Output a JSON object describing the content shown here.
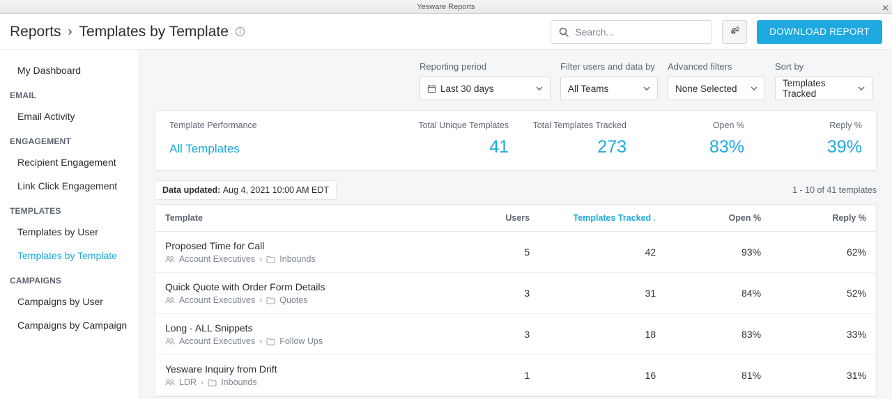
{
  "window": {
    "title": "Yesware Reports"
  },
  "breadcrumb": {
    "root": "Reports",
    "current": "Templates by Template"
  },
  "search": {
    "placeholder": "Search..."
  },
  "download_btn": "DOWNLOAD REPORT",
  "sidebar": {
    "my_dashboard": "My Dashboard",
    "sections": [
      {
        "heading": "EMAIL",
        "items": [
          "Email Activity"
        ]
      },
      {
        "heading": "ENGAGEMENT",
        "items": [
          "Recipient Engagement",
          "Link Click Engagement"
        ]
      },
      {
        "heading": "TEMPLATES",
        "items": [
          "Templates by User",
          "Templates by Template"
        ]
      },
      {
        "heading": "CAMPAIGNS",
        "items": [
          "Campaigns by User",
          "Campaigns by Campaign"
        ]
      }
    ],
    "active": "Templates by Template"
  },
  "filters": {
    "period": {
      "label": "Reporting period",
      "value": "Last 30 days"
    },
    "users": {
      "label": "Filter users and data by",
      "value": "All Teams"
    },
    "advanced": {
      "label": "Advanced filters",
      "value": "None Selected"
    },
    "sort": {
      "label": "Sort by",
      "value": "Templates Tracked"
    }
  },
  "perf": {
    "headers": [
      "Template Performance",
      "Total Unique Templates",
      "Total Templates Tracked",
      "Open %",
      "Reply %"
    ],
    "name": "All Templates",
    "values": [
      "41",
      "273",
      "83%",
      "39%"
    ]
  },
  "updated": {
    "label": "Data updated: ",
    "ts": "Aug 4, 2021 10:00 AM EDT"
  },
  "range": "1 - 10 of 41 templates",
  "table": {
    "headers": {
      "template": "Template",
      "users": "Users",
      "tracked": "Templates Tracked",
      "open": "Open %",
      "reply": "Reply %"
    },
    "rows": [
      {
        "name": "Proposed Time for Call",
        "group": "Account Executives",
        "folder": "Inbounds",
        "users": "5",
        "tracked": "42",
        "open": "93%",
        "reply": "62%"
      },
      {
        "name": "Quick Quote with Order Form Details",
        "group": "Account Executives",
        "folder": "Quotes",
        "users": "3",
        "tracked": "31",
        "open": "84%",
        "reply": "52%"
      },
      {
        "name": "Long - ALL Snippets",
        "group": "Account Executives",
        "folder": "Follow Ups",
        "users": "3",
        "tracked": "18",
        "open": "83%",
        "reply": "33%"
      },
      {
        "name": "Yesware Inquiry from Drift",
        "group": "LDR",
        "folder": "Inbounds",
        "users": "1",
        "tracked": "16",
        "open": "81%",
        "reply": "31%"
      }
    ]
  }
}
